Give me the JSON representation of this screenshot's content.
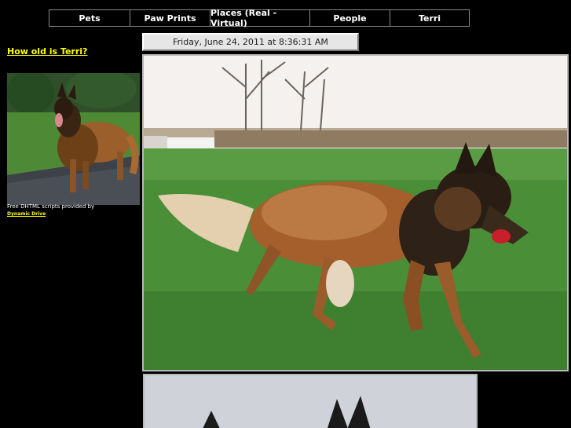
{
  "nav": {
    "items": [
      {
        "label": "Pets"
      },
      {
        "label": "Paw Prints"
      },
      {
        "label": "Places (Real - Virtual)"
      },
      {
        "label": "People"
      },
      {
        "label": "Terri"
      }
    ]
  },
  "datetime": "Friday, June 24, 2011 at 8:36:31 AM",
  "sidebar": {
    "age_link": "How old is Terri?",
    "credit_text": "Free DHTML scripts provided by",
    "credit_link": "Dynamic Drive"
  },
  "colors": {
    "background": "#000000",
    "link": "#ffff00",
    "nav_text": "#ffffff",
    "border": "#8a8a8a"
  }
}
